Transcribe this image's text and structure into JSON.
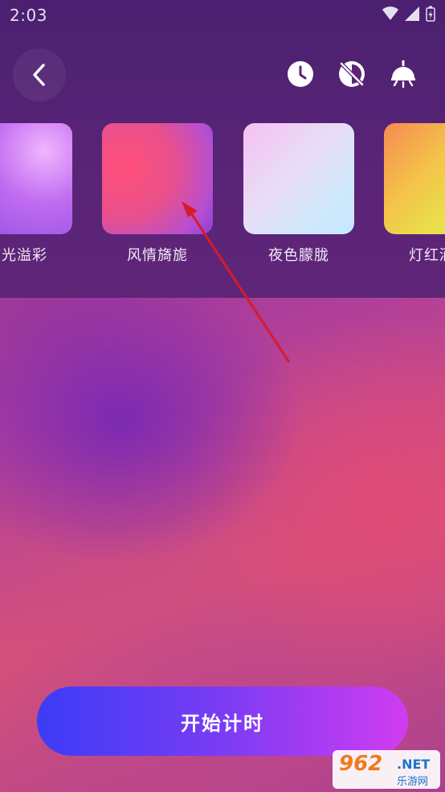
{
  "status": {
    "time": "2:03"
  },
  "toolbar": {
    "back_icon": "chevron-left-icon",
    "timer_icon": "clock-icon",
    "mode_icon": "brightness-off-icon",
    "lamp_icon": "lamp-icon"
  },
  "themes": [
    {
      "label": "炫光溢彩"
    },
    {
      "label": "风情旖旎"
    },
    {
      "label": "夜色朦胧"
    },
    {
      "label": "灯红酒绿"
    }
  ],
  "action": {
    "start_label": "开始计时"
  },
  "watermark": {
    "main": "962",
    "net": ".NET",
    "sub": "乐游网"
  },
  "colors": {
    "accent_start": "#3c3cf6",
    "accent_end": "#d13cf0",
    "annotation_arrow": "#d81b2a"
  }
}
